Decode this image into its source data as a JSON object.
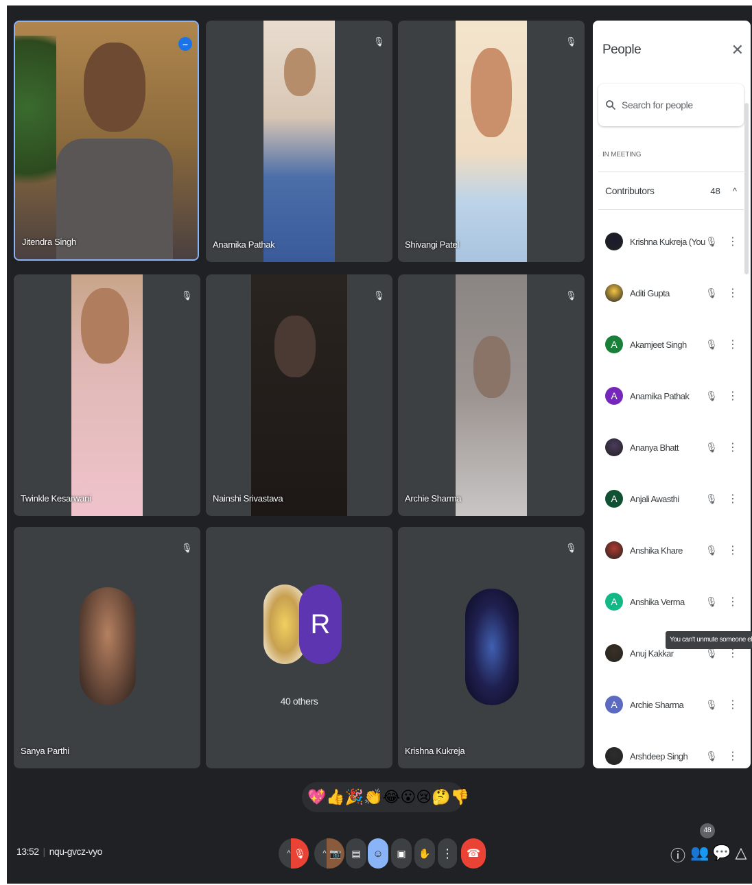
{
  "meeting": {
    "time": "13:52",
    "code": "nqu-gvcz-vyo"
  },
  "tiles": [
    {
      "name": "Jitendra Singh"
    },
    {
      "name": "Anamika Pathak"
    },
    {
      "name": "Shivangi Patel"
    },
    {
      "name": "Twinkle Kesarwani"
    },
    {
      "name": "Nainshi Srivastava"
    },
    {
      "name": "Archie Sharma"
    },
    {
      "name": "Sanya Parthi"
    },
    {
      "name": "",
      "others_label": "40 others",
      "avatar_letter": "R"
    },
    {
      "name": "Krishna Kukreja"
    }
  ],
  "people_panel": {
    "title": "People",
    "close_icon": "close-icon",
    "search_placeholder": "Search for people",
    "section_label": "IN MEETING",
    "group": {
      "label": "Contributors",
      "count": "48"
    },
    "people": [
      {
        "name": "Krishna Kukreja (You)",
        "avatar": "photo",
        "color": "#1a1a2e"
      },
      {
        "name": "Aditi Gupta",
        "avatar": "photo",
        "color": "#f5c542"
      },
      {
        "name": "Akamjeet Singh",
        "avatar": "A",
        "color": "#188038"
      },
      {
        "name": "Anamika Pathak",
        "avatar": "A",
        "color": "#7627bb"
      },
      {
        "name": "Ananya Bhatt",
        "avatar": "photo",
        "color": "#4a3b5c"
      },
      {
        "name": "Anjali Awasthi",
        "avatar": "A",
        "color": "#0f5132"
      },
      {
        "name": "Anshika Khare",
        "avatar": "photo",
        "color": "#b03a2e"
      },
      {
        "name": "Anshika Verma",
        "avatar": "A",
        "color": "#12b886"
      },
      {
        "name": "Anuj Kakkar",
        "avatar": "photo",
        "color": "#3b3024"
      },
      {
        "name": "Archie Sharma",
        "avatar": "A",
        "color": "#5c6bc0"
      },
      {
        "name": "Arshdeep Singh",
        "avatar": "photo",
        "color": "#2d2d2d"
      }
    ],
    "tooltip": "You can't unmute someone else",
    "people_badge": "48"
  },
  "reactions": [
    "💖",
    "👍",
    "🎉",
    "👏",
    "😂",
    "😮",
    "😢",
    "🤔",
    "👎"
  ],
  "colors": {
    "background": "#202124",
    "tile": "#3c4043",
    "accent": "#1a73e8",
    "hangup": "#ea4335"
  }
}
